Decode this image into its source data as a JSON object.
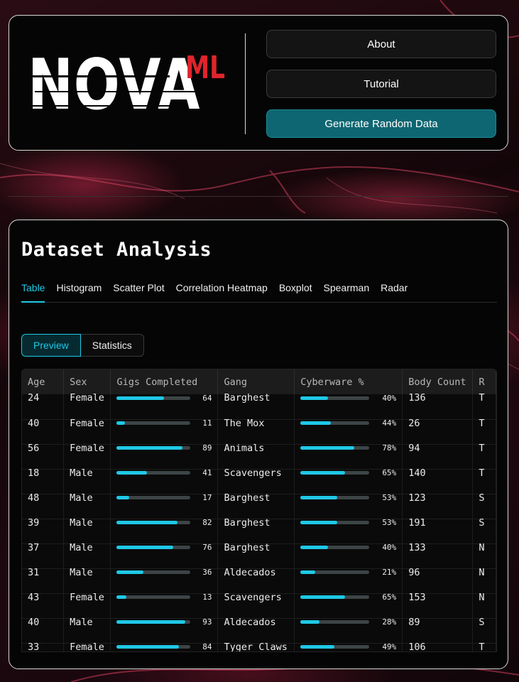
{
  "header": {
    "logo_text": "NOVA",
    "logo_suffix": "ML",
    "buttons": {
      "about": "About",
      "tutorial": "Tutorial",
      "generate": "Generate Random Data"
    }
  },
  "analysis": {
    "title": "Dataset Analysis",
    "tabs": [
      "Table",
      "Histogram",
      "Scatter Plot",
      "Correlation Heatmap",
      "Boxplot",
      "Spearman",
      "Radar"
    ],
    "active_tab": "Table",
    "views": [
      "Preview",
      "Statistics"
    ],
    "active_view": "Preview",
    "columns": [
      "Age",
      "Sex",
      "Gigs Completed",
      "Gang",
      "Cyberware %",
      "Body Count",
      "R"
    ],
    "rows": [
      {
        "age": "24",
        "sex": "Female",
        "gigs": 64,
        "gang": "Barghest",
        "cyber": 40,
        "body": "136",
        "r": "T"
      },
      {
        "age": "40",
        "sex": "Female",
        "gigs": 11,
        "gang": "The Mox",
        "cyber": 44,
        "body": "26",
        "r": "T"
      },
      {
        "age": "56",
        "sex": "Female",
        "gigs": 89,
        "gang": "Animals",
        "cyber": 78,
        "body": "94",
        "r": "T"
      },
      {
        "age": "18",
        "sex": "Male",
        "gigs": 41,
        "gang": "Scavengers",
        "cyber": 65,
        "body": "140",
        "r": "T"
      },
      {
        "age": "48",
        "sex": "Male",
        "gigs": 17,
        "gang": "Barghest",
        "cyber": 53,
        "body": "123",
        "r": "S"
      },
      {
        "age": "39",
        "sex": "Male",
        "gigs": 82,
        "gang": "Barghest",
        "cyber": 53,
        "body": "191",
        "r": "S"
      },
      {
        "age": "37",
        "sex": "Male",
        "gigs": 76,
        "gang": "Barghest",
        "cyber": 40,
        "body": "133",
        "r": "N"
      },
      {
        "age": "31",
        "sex": "Male",
        "gigs": 36,
        "gang": "Aldecados",
        "cyber": 21,
        "body": "96",
        "r": "N"
      },
      {
        "age": "43",
        "sex": "Female",
        "gigs": 13,
        "gang": "Scavengers",
        "cyber": 65,
        "body": "153",
        "r": "N"
      },
      {
        "age": "40",
        "sex": "Male",
        "gigs": 93,
        "gang": "Aldecados",
        "cyber": 28,
        "body": "89",
        "r": "S"
      },
      {
        "age": "33",
        "sex": "Female",
        "gigs": 84,
        "gang": "Tyger Claws",
        "cyber": 49,
        "body": "106",
        "r": "T"
      }
    ]
  },
  "colors": {
    "accent": "#1fc8e6",
    "generate_button": "#0e6672",
    "logo_red": "#e0242c"
  }
}
